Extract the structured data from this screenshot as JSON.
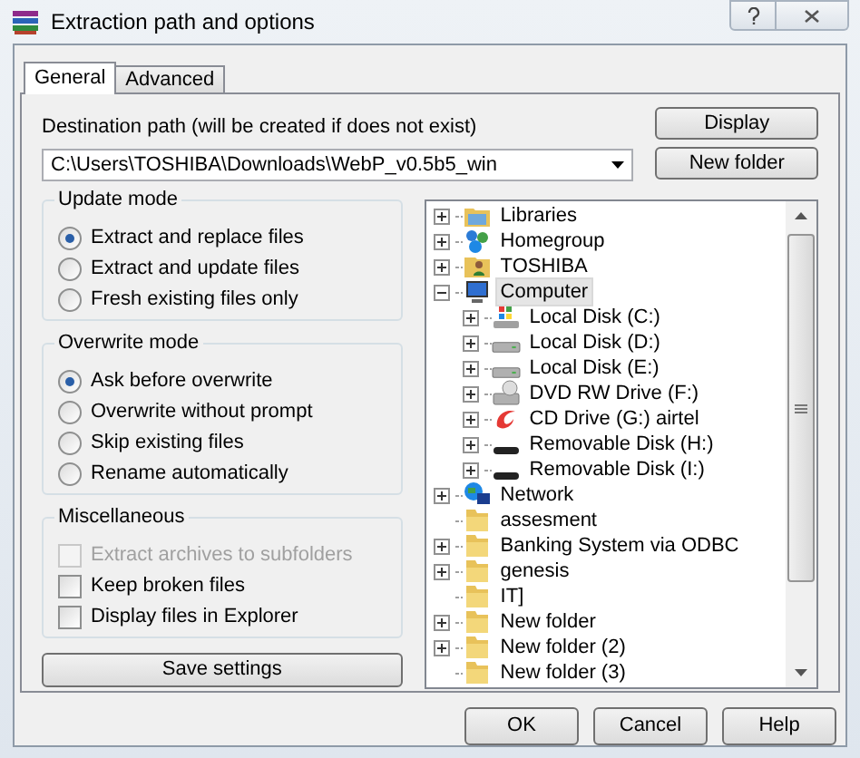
{
  "window": {
    "title": "Extraction path and options"
  },
  "tabs": [
    {
      "label": "General",
      "selected": true
    },
    {
      "label": "Advanced",
      "selected": false
    }
  ],
  "destination": {
    "label": "Destination path (will be created if does not exist)",
    "value": "C:\\Users\\TOSHIBA\\Downloads\\WebP_v0.5b5_win"
  },
  "side_buttons": [
    "Display",
    "New folder"
  ],
  "update_mode": {
    "title": "Update mode",
    "options": [
      {
        "label": "Extract and replace files",
        "selected": true
      },
      {
        "label": "Extract and update files",
        "selected": false
      },
      {
        "label": "Fresh existing files only",
        "selected": false
      }
    ]
  },
  "overwrite_mode": {
    "title": "Overwrite mode",
    "options": [
      {
        "label": "Ask before overwrite",
        "selected": true
      },
      {
        "label": "Overwrite without prompt",
        "selected": false
      },
      {
        "label": "Skip existing files",
        "selected": false
      },
      {
        "label": "Rename automatically",
        "selected": false
      }
    ]
  },
  "miscellaneous": {
    "title": "Miscellaneous",
    "options": [
      {
        "label": "Extract archives to subfolders",
        "checked": false,
        "disabled": true
      },
      {
        "label": "Keep broken files",
        "checked": false,
        "disabled": false
      },
      {
        "label": "Display files in Explorer",
        "checked": false,
        "disabled": false
      }
    ]
  },
  "save_button": "Save settings",
  "tree": [
    {
      "label": "Libraries",
      "kind": "libraries",
      "expandable": true,
      "selected": false
    },
    {
      "label": "Homegroup",
      "kind": "homegroup",
      "expandable": true,
      "selected": false
    },
    {
      "label": "TOSHIBA",
      "kind": "user",
      "expandable": true,
      "selected": false
    },
    {
      "label": "Computer",
      "kind": "computer",
      "expandable": true,
      "expanded": true,
      "selected": true,
      "children": [
        {
          "label": "Local Disk (C:)",
          "kind": "system-disk",
          "expandable": true,
          "selected": false
        },
        {
          "label": "Local Disk (D:)",
          "kind": "disk",
          "expandable": true,
          "selected": false
        },
        {
          "label": "Local Disk (E:)",
          "kind": "disk",
          "expandable": true,
          "selected": false
        },
        {
          "label": "DVD RW Drive (F:)",
          "kind": "dvd",
          "expandable": true,
          "selected": false
        },
        {
          "label": "CD Drive (G:) airtel",
          "kind": "cd",
          "expandable": true,
          "selected": false
        },
        {
          "label": "Removable Disk (H:)",
          "kind": "removable",
          "expandable": true,
          "selected": false
        },
        {
          "label": "Removable Disk (I:)",
          "kind": "removable",
          "expandable": true,
          "selected": false
        }
      ]
    },
    {
      "label": "Network",
      "kind": "network",
      "expandable": true,
      "selected": false
    },
    {
      "label": "assesment",
      "kind": "folder",
      "expandable": false,
      "selected": false
    },
    {
      "label": "Banking System via ODBC",
      "kind": "folder",
      "expandable": true,
      "selected": false
    },
    {
      "label": "genesis",
      "kind": "folder",
      "expandable": true,
      "selected": false
    },
    {
      "label": "IT]",
      "kind": "folder",
      "expandable": false,
      "selected": false
    },
    {
      "label": "New folder",
      "kind": "folder",
      "expandable": true,
      "selected": false
    },
    {
      "label": "New folder (2)",
      "kind": "folder",
      "expandable": true,
      "selected": false
    },
    {
      "label": "New folder (3)",
      "kind": "folder",
      "expandable": false,
      "selected": false
    }
  ],
  "buttons": [
    "OK",
    "Cancel",
    "Help"
  ]
}
